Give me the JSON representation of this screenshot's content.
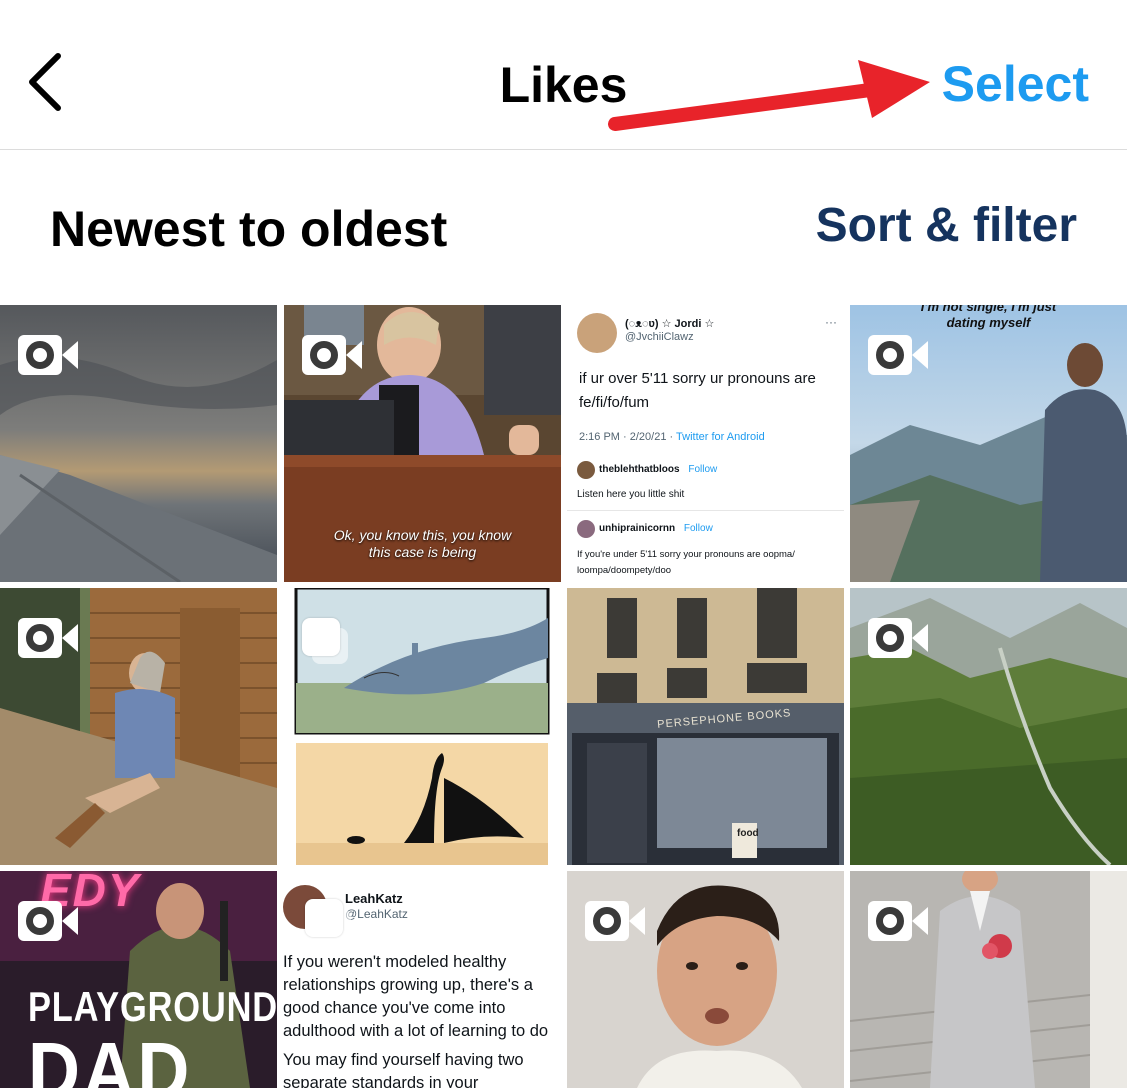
{
  "nav": {
    "title": "Likes",
    "select_label": "Select",
    "back_icon": "chevron-left-icon",
    "accent": "#1d9bf0",
    "annotation_arrow_color": "#e8232a"
  },
  "sort": {
    "label": "Newest to oldest",
    "filter_label": "Sort & filter",
    "filter_color": "#15335e"
  },
  "tiles": [
    {
      "icon": "video-icon"
    },
    {
      "icon": "video-icon",
      "caption_line1": "Ok, you know this, you know",
      "caption_line2": "this case is being"
    },
    {
      "display_name": "(◌ᴥ◌ʋ) ☆ Jordi ☆",
      "handle": "@JvchiiClawz",
      "text_line1": "if ur over 5'11 sorry ur pronouns are",
      "text_line2": "fe/fi/fo/fum",
      "timestamp": "2:16 PM · 2/20/21 ·",
      "source": "Twitter for Android",
      "reply1_name": "theblehthatbloos",
      "reply1_follow": "Follow",
      "reply1_text": "Listen here you little shit",
      "reply2_name": "unhiprainicornn",
      "reply2_follow": "Follow",
      "reply2_text_line1": "If you're under 5'11 sorry your pronouns are oopma/",
      "reply2_text_line2": "loompa/doompety/doo"
    },
    {
      "icon": "video-icon",
      "overlay_line1": "I'm not single, I'm just",
      "overlay_line2": "dating myself"
    },
    {
      "icon": "video-icon"
    },
    {
      "icon": "multiple-images-icon"
    },
    {
      "icon": "none",
      "storefront_sign": "PERSEPHONE BOOKS",
      "board_text": "food"
    },
    {
      "icon": "video-icon"
    },
    {
      "icon": "video-icon",
      "neon_text": "EDY",
      "title_text": "PLAYGROUND",
      "title_text2": "DAD"
    },
    {
      "icon": "multiple-images-icon",
      "display_name": "LeahKatz",
      "handle": "@LeahKatz",
      "line1": "If you weren't modeled healthy",
      "line2": "relationships growing up, there's a",
      "line3": "good chance you've come into",
      "line4": "adulthood with a lot of learning to do",
      "line5": "You may find yourself having two",
      "line6": "separate standards in your"
    },
    {
      "icon": "video-icon"
    },
    {
      "icon": "video-icon"
    }
  ]
}
